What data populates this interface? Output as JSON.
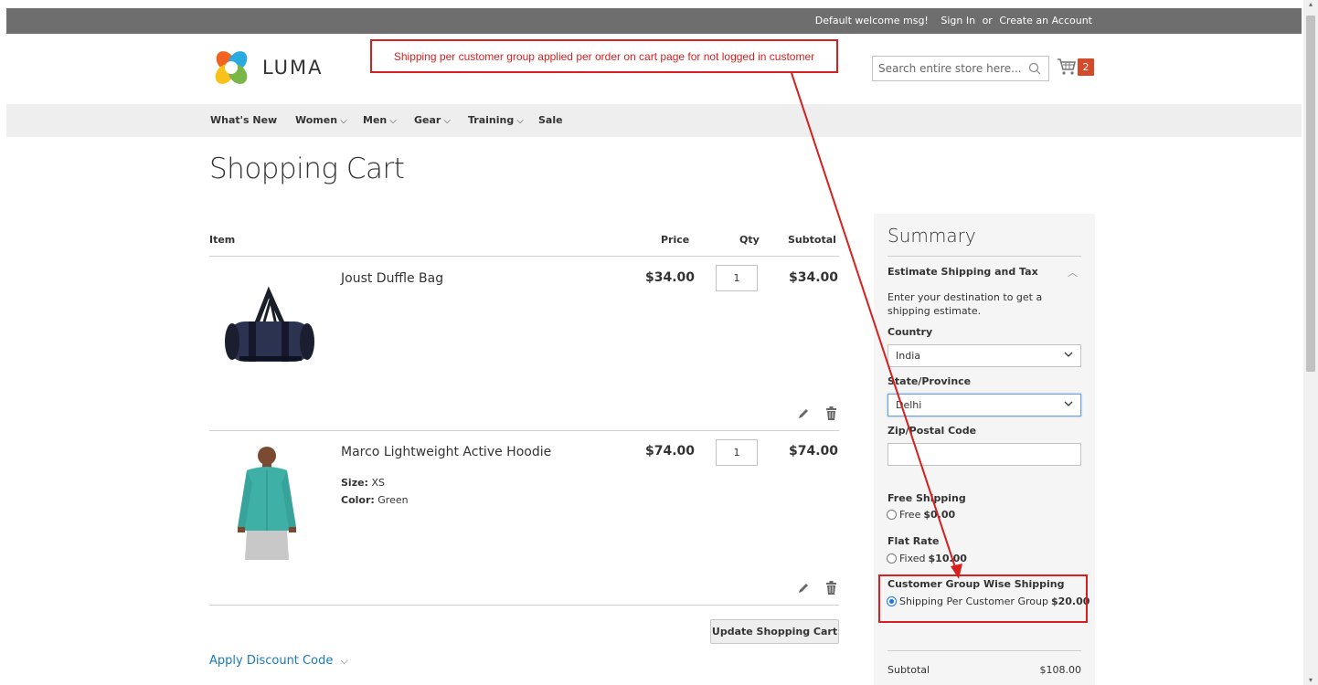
{
  "header": {
    "welcome": "Default welcome msg!",
    "sign_in": "Sign In",
    "or": "or",
    "create_account": "Create an Account",
    "logo_text": "LUMA",
    "search_placeholder": "Search entire store here...",
    "cart_count": "2"
  },
  "annotation": {
    "text": "Shipping per customer group applied per order on cart page for not logged in customer",
    "color": "#d61f1f"
  },
  "nav": {
    "items": [
      {
        "label": "What's New",
        "has_menu": false
      },
      {
        "label": "Women",
        "has_menu": true
      },
      {
        "label": "Men",
        "has_menu": true
      },
      {
        "label": "Gear",
        "has_menu": true
      },
      {
        "label": "Training",
        "has_menu": true
      },
      {
        "label": "Sale",
        "has_menu": false
      }
    ]
  },
  "page": {
    "title": "Shopping Cart"
  },
  "cart": {
    "columns": {
      "item": "Item",
      "price": "Price",
      "qty": "Qty",
      "subtotal": "Subtotal"
    },
    "items": [
      {
        "name": "Joust Duffle Bag",
        "price": "$34.00",
        "qty": "1",
        "subtotal": "$34.00",
        "image_icon": "duffle-bag-image"
      },
      {
        "name": "Marco Lightweight Active Hoodie",
        "price": "$74.00",
        "qty": "1",
        "subtotal": "$74.00",
        "image_icon": "hoodie-model-image",
        "options": [
          {
            "label": "Size:",
            "value": "XS"
          },
          {
            "label": "Color:",
            "value": "Green"
          }
        ]
      }
    ],
    "update_button": "Update Shopping Cart",
    "discount_link": "Apply Discount Code"
  },
  "summary": {
    "title": "Summary",
    "estimate_heading": "Estimate Shipping and Tax",
    "estimate_text": "Enter your destination to get a shipping estimate.",
    "country_label": "Country",
    "country_value": "India",
    "state_label": "State/Province",
    "state_value": "Delhi",
    "zip_label": "Zip/Postal Code",
    "zip_value": "",
    "methods": [
      {
        "carrier": "Free Shipping",
        "method": "Free",
        "price": "$0.00",
        "selected": false
      },
      {
        "carrier": "Flat Rate",
        "method": "Fixed",
        "price": "$10.00",
        "selected": false
      },
      {
        "carrier": "Customer Group Wise Shipping",
        "method": "Shipping Per Customer Group",
        "price": "$20.00",
        "selected": true
      }
    ],
    "subtotal_label": "Subtotal",
    "subtotal_value": "$108.00"
  },
  "colors": {
    "topbar": "#6e6e6e",
    "nav_bg": "#eeeeee",
    "link_blue": "#1979c3",
    "cart_badge": "#d44a2a",
    "annotation_red": "#d61f1f"
  }
}
